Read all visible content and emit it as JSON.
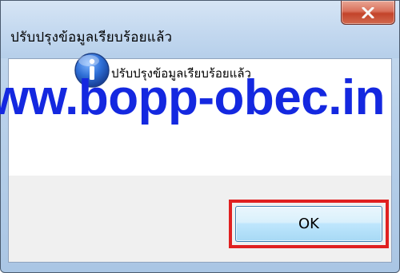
{
  "dialog": {
    "title": "ปรับปรุงข้อมูลเรียบร้อยแล้ว",
    "message": "ปรับปรุงข้อมูลเรียบร้อยแล้ว",
    "ok_label": "OK",
    "icon": "info-icon",
    "close_icon": "close-icon"
  },
  "watermark": {
    "text": "ww.bopp-obec.in"
  },
  "colors": {
    "title_bar": "#c3d8ef",
    "close_button": "#c3432a",
    "content_background": "#f0f0f0",
    "message_area": "#ffffff",
    "watermark": "#1428e0",
    "highlight_box": "#e02020",
    "ok_button": "#bee6fd"
  }
}
